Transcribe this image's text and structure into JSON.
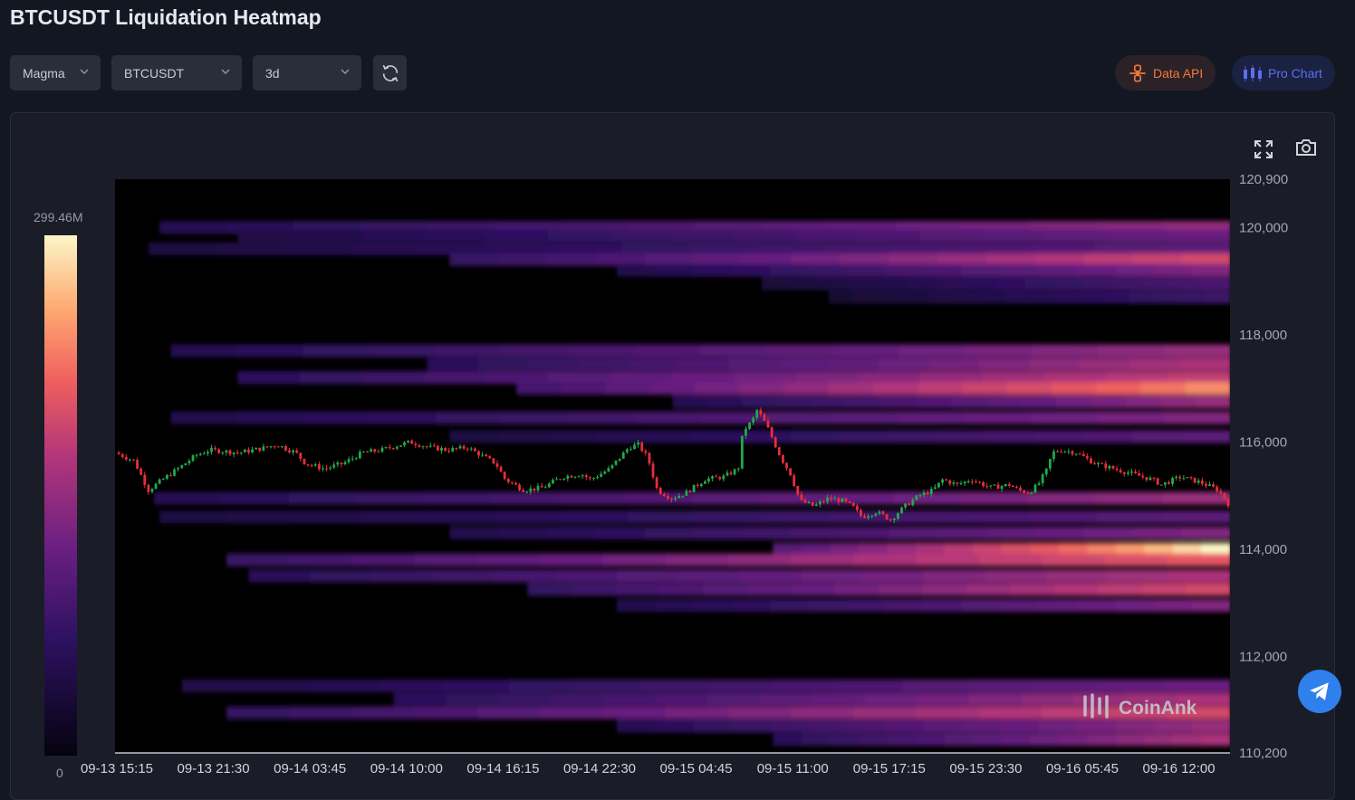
{
  "page": {
    "title": "BTCUSDT Liquidation Heatmap"
  },
  "toolbar": {
    "theme_select": {
      "value": "Magma"
    },
    "symbol_select": {
      "value": "BTCUSDT"
    },
    "range_select": {
      "value": "3d"
    },
    "refresh_icon": "refresh-icon",
    "data_api_label": "Data API",
    "pro_chart_label": "Pro Chart"
  },
  "colors": {
    "background": "#131722",
    "candle_up": "#1faa4a",
    "candle_down": "#ea2d3a",
    "data_api": "#f0793a",
    "pro_chart": "#5b6ff5",
    "telegram": "#2f80ed"
  },
  "watermark": "CoinAnk",
  "chart_data": {
    "type": "heatmap",
    "title": "",
    "colorscale": "Magma",
    "colorbar": {
      "max_label": "299.46M",
      "min_label": "0",
      "max": 299.46,
      "min": 0,
      "unit": "M"
    },
    "x_ticks": [
      "09-13 15:15",
      "09-13 21:30",
      "09-14 03:45",
      "09-14 10:00",
      "09-14 16:15",
      "09-14 22:30",
      "09-15 04:45",
      "09-15 11:00",
      "09-15 17:15",
      "09-15 23:30",
      "09-16 05:45",
      "09-16 12:00"
    ],
    "y_ticks": [
      "120,900",
      "120,000",
      "118,000",
      "116,000",
      "114,000",
      "112,000",
      "110,200"
    ],
    "ylim": [
      110200,
      120900
    ],
    "y_tick_values": [
      120900,
      120000,
      118000,
      116000,
      114000,
      112000,
      110200
    ],
    "price_path": [
      [
        0,
        115800
      ],
      [
        0.02,
        115650
      ],
      [
        0.035,
        115100
      ],
      [
        0.05,
        115300
      ],
      [
        0.07,
        115550
      ],
      [
        0.085,
        115750
      ],
      [
        0.1,
        115850
      ],
      [
        0.13,
        115800
      ],
      [
        0.16,
        115900
      ],
      [
        0.17,
        115950
      ],
      [
        0.19,
        115800
      ],
      [
        0.2,
        115600
      ],
      [
        0.22,
        115500
      ],
      [
        0.24,
        115600
      ],
      [
        0.26,
        115800
      ],
      [
        0.28,
        115850
      ],
      [
        0.3,
        115950
      ],
      [
        0.31,
        116000
      ],
      [
        0.33,
        115900
      ],
      [
        0.35,
        115850
      ],
      [
        0.37,
        115900
      ],
      [
        0.385,
        115750
      ],
      [
        0.4,
        115600
      ],
      [
        0.41,
        115300
      ],
      [
        0.43,
        115100
      ],
      [
        0.45,
        115150
      ],
      [
        0.47,
        115350
      ],
      [
        0.49,
        115400
      ],
      [
        0.5,
        115300
      ],
      [
        0.52,
        115500
      ],
      [
        0.54,
        115900
      ],
      [
        0.55,
        115950
      ],
      [
        0.56,
        115700
      ],
      [
        0.57,
        115100
      ],
      [
        0.585,
        114950
      ],
      [
        0.6,
        115050
      ],
      [
        0.62,
        115300
      ],
      [
        0.64,
        115350
      ],
      [
        0.655,
        115500
      ],
      [
        0.66,
        116200
      ],
      [
        0.67,
        116400
      ],
      [
        0.675,
        116600
      ],
      [
        0.685,
        116300
      ],
      [
        0.695,
        115900
      ],
      [
        0.7,
        115700
      ],
      [
        0.71,
        115400
      ],
      [
        0.72,
        114900
      ],
      [
        0.735,
        114800
      ],
      [
        0.75,
        114950
      ],
      [
        0.765,
        114900
      ],
      [
        0.775,
        114800
      ],
      [
        0.785,
        114600
      ],
      [
        0.8,
        114700
      ],
      [
        0.815,
        114550
      ],
      [
        0.83,
        114800
      ],
      [
        0.845,
        115000
      ],
      [
        0.86,
        115100
      ],
      [
        0.87,
        115300
      ],
      [
        0.885,
        115200
      ],
      [
        0.9,
        115300
      ],
      [
        0.92,
        115150
      ],
      [
        0.94,
        115200
      ],
      [
        0.95,
        115100
      ],
      [
        0.96,
        115050
      ],
      [
        0.97,
        115200
      ],
      [
        0.98,
        115500
      ],
      [
        0.985,
        115800
      ],
      [
        0.995,
        115850
      ],
      [
        1.01,
        115800
      ],
      [
        1.03,
        115600
      ],
      [
        1.05,
        115500
      ],
      [
        1.07,
        115400
      ],
      [
        1.09,
        115300
      ],
      [
        1.1,
        115200
      ],
      [
        1.12,
        115350
      ],
      [
        1.14,
        115250
      ],
      [
        1.16,
        115100
      ],
      [
        1.17,
        114850
      ]
    ],
    "liquidation_bands": [
      {
        "price": 120000,
        "intensity": 0.55,
        "start": 0.04
      },
      {
        "price": 119850,
        "intensity": 0.45,
        "start": 0.11
      },
      {
        "price": 119600,
        "intensity": 0.4,
        "start": 0.03
      },
      {
        "price": 119400,
        "intensity": 0.7,
        "start": 0.3
      },
      {
        "price": 119200,
        "intensity": 0.5,
        "start": 0.45
      },
      {
        "price": 118950,
        "intensity": 0.35,
        "start": 0.58
      },
      {
        "price": 118700,
        "intensity": 0.3,
        "start": 0.64
      },
      {
        "price": 117700,
        "intensity": 0.55,
        "start": 0.05
      },
      {
        "price": 117450,
        "intensity": 0.6,
        "start": 0.28
      },
      {
        "price": 117200,
        "intensity": 0.65,
        "start": 0.11
      },
      {
        "price": 117000,
        "intensity": 0.85,
        "start": 0.36
      },
      {
        "price": 116750,
        "intensity": 0.55,
        "start": 0.5
      },
      {
        "price": 116450,
        "intensity": 0.5,
        "start": 0.05
      },
      {
        "price": 116100,
        "intensity": 0.4,
        "start": 0.3
      },
      {
        "price": 114950,
        "intensity": 0.55,
        "start": 0.035
      },
      {
        "price": 114600,
        "intensity": 0.4,
        "start": 0.04
      },
      {
        "price": 114300,
        "intensity": 0.5,
        "start": 0.3
      },
      {
        "price": 114000,
        "intensity": 1.0,
        "start": 0.59
      },
      {
        "price": 113800,
        "intensity": 0.75,
        "start": 0.1
      },
      {
        "price": 113500,
        "intensity": 0.6,
        "start": 0.12
      },
      {
        "price": 113250,
        "intensity": 0.7,
        "start": 0.37
      },
      {
        "price": 112950,
        "intensity": 0.5,
        "start": 0.45
      },
      {
        "price": 111450,
        "intensity": 0.45,
        "start": 0.06
      },
      {
        "price": 111200,
        "intensity": 0.6,
        "start": 0.25
      },
      {
        "price": 110950,
        "intensity": 0.7,
        "start": 0.1
      },
      {
        "price": 110700,
        "intensity": 0.55,
        "start": 0.45
      },
      {
        "price": 110450,
        "intensity": 0.6,
        "start": 0.59
      }
    ]
  }
}
